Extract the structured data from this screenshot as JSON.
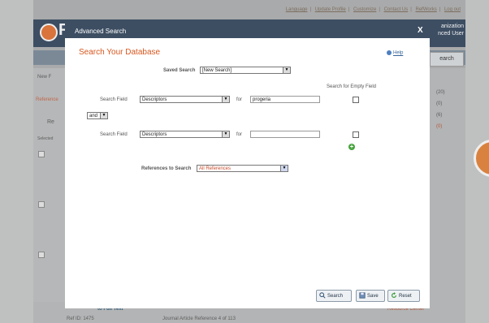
{
  "background": {
    "top_links": [
      "Language",
      "Update Profile",
      "Customize",
      "Contact Us",
      "RefWorks",
      "Log out"
    ],
    "logo_letter": "F",
    "org_line1": "anization",
    "org_line2": "nced User",
    "search_button": "earch",
    "new_button": "New F",
    "left_refs_label": "Reference",
    "left_re": "Re",
    "left_sel": "Selected",
    "right_counts": [
      "(20)",
      "(0)",
      "(6)",
      "(0)"
    ],
    "bottom_text": "to Full Text",
    "bottom_ref": "Ref ID: 1475",
    "bottom_journal": "Journal Article  Reference 4 of 113",
    "right_link": "Resource Center"
  },
  "modal": {
    "title": "Advanced Search",
    "close_label": "X",
    "heading": "Search Your Database",
    "help_label": "Help",
    "saved_search_label": "Saved Search",
    "saved_search_value": "[New Search]",
    "empty_field_header": "Search for Empty Field",
    "row1": {
      "label": "Search Field",
      "field": "Descriptors",
      "for_label": "for",
      "value": "progeria"
    },
    "operator": "and",
    "row2": {
      "label": "Search Field",
      "field": "Descriptors",
      "for_label": "for",
      "value": ""
    },
    "references_label": "References to Search",
    "references_value": "All References",
    "buttons": {
      "search": "Search",
      "save": "Save",
      "reset": "Reset"
    }
  }
}
